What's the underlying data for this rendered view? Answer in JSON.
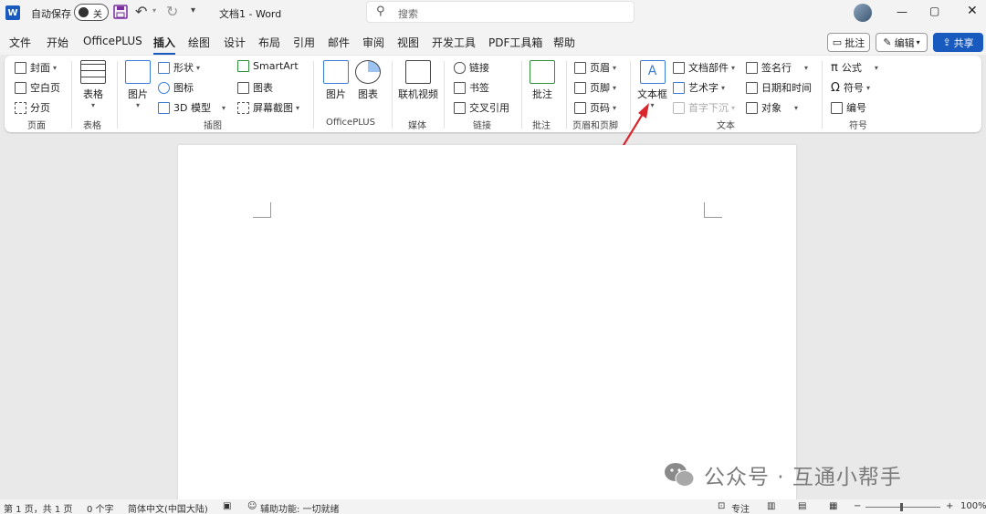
{
  "titlebar": {
    "logo": "W",
    "autosave_label": "自动保存",
    "autosave_state": "关",
    "doc_title": "文档1 - Word",
    "search_placeholder": "搜索",
    "window_controls": {
      "min": "—",
      "max": "▢",
      "close": "✕"
    }
  },
  "menu": {
    "tabs": [
      "文件",
      "开始",
      "OfficePLUS",
      "插入",
      "绘图",
      "设计",
      "布局",
      "引用",
      "邮件",
      "审阅",
      "视图",
      "开发工具",
      "PDF工具箱",
      "帮助"
    ],
    "active_tab": "插入",
    "comment_btn": "批注",
    "edit_btn": "编辑",
    "share_btn": "共享"
  },
  "ribbon": {
    "pages": {
      "cover": "封面",
      "blank": "空白页",
      "break": "分页",
      "group": "页面"
    },
    "table": {
      "label": "表格",
      "group": "表格"
    },
    "illustrations": {
      "picture": "图片",
      "shapes": "形状",
      "icons": "图标",
      "model3d": "3D 模型",
      "smartart": "SmartArt",
      "chart": "图表",
      "screenshot": "屏幕截图",
      "group": "插图"
    },
    "officeplus": {
      "picture": "图片",
      "chart": "图表",
      "group": "OfficePLUS"
    },
    "media": {
      "video": "联机视频",
      "group": "媒体"
    },
    "links": {
      "link": "链接",
      "bookmark": "书签",
      "crossref": "交叉引用",
      "group": "链接"
    },
    "comments": {
      "comment": "批注",
      "group": "批注"
    },
    "header_footer": {
      "header": "页眉",
      "footer": "页脚",
      "page_number": "页码",
      "group": "页眉和页脚"
    },
    "text": {
      "textbox": "文本框",
      "quickparts": "文档部件",
      "wordart": "艺术字",
      "dropcap": "首字下沉",
      "signature": "签名行",
      "datetime": "日期和时间",
      "object": "对象",
      "group": "文本"
    },
    "symbols": {
      "equation": "公式",
      "symbol": "符号",
      "number": "编号",
      "group": "符号"
    }
  },
  "watermark": "公众号 · 互通小帮手",
  "status": {
    "page": "第 1 页，共 1 页",
    "words": "0 个字",
    "lang": "简体中文(中国大陆)",
    "accessibility": "辅助功能: 一切就绪",
    "focus": "专注",
    "zoom": "100%"
  },
  "colors": {
    "accent": "#185abd",
    "arrow": "#d9262c"
  }
}
